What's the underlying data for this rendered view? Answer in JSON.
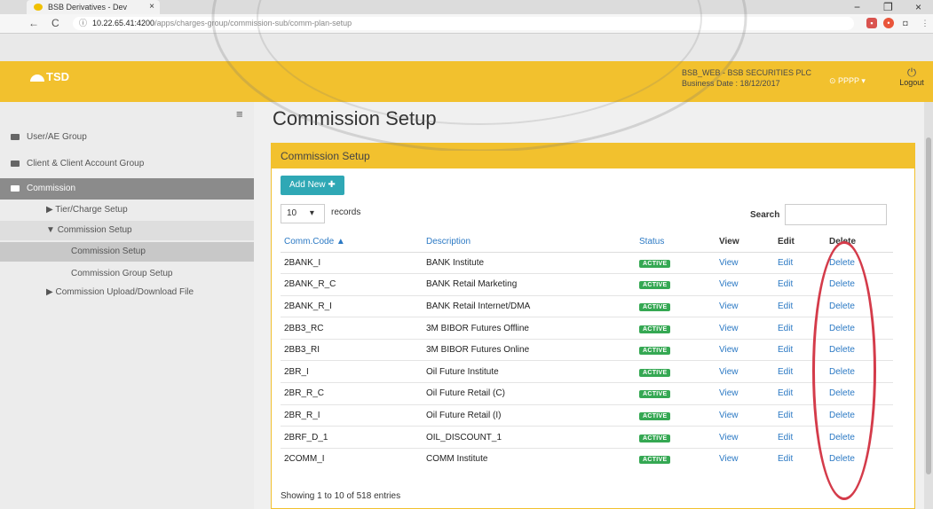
{
  "browser": {
    "tab_title": "BSB Derivatives - Dev",
    "tab_close": "×",
    "url_host": "10.22.65.41:4200",
    "url_path": "/apps/charges-group/commission-sub/comm-plan-setup",
    "back": "←",
    "reload": "C",
    "info": "ⓘ",
    "min": "−",
    "max": "❐",
    "close": "×"
  },
  "header": {
    "brand": "TSD",
    "company": "BSB_WEB - BSB SECURITIES PLC",
    "business_date": "Business Date : 18/12/2017",
    "user": "PPPP",
    "logout": "Logout"
  },
  "sidebar": {
    "items": [
      {
        "label": "User/AE Group"
      },
      {
        "label": "Client & Client Account Group"
      },
      {
        "label": "Commission"
      }
    ],
    "sub": [
      {
        "label": "Tier/Charge Setup"
      },
      {
        "label": "Commission Setup"
      },
      {
        "label": "Commission Setup"
      },
      {
        "label": "Commission Group Setup"
      },
      {
        "label": "Commission Upload/Download File"
      }
    ]
  },
  "main": {
    "title": "Commission Setup",
    "panel_title": "Commission Setup",
    "add_button": "Add New",
    "length_value": "10",
    "length_label": "records",
    "search_label": "Search",
    "columns": [
      "Comm.Code ▲",
      "Description",
      "Status",
      "View",
      "Edit",
      "Delete"
    ],
    "rows": [
      {
        "code": "2BANK_I",
        "desc": "BANK Institute",
        "status": "ACTIVE",
        "view": "View",
        "edit": "Edit",
        "delete": "Delete"
      },
      {
        "code": "2BANK_R_C",
        "desc": "BANK Retail Marketing",
        "status": "ACTIVE",
        "view": "View",
        "edit": "Edit",
        "delete": "Delete"
      },
      {
        "code": "2BANK_R_I",
        "desc": "BANK Retail Internet/DMA",
        "status": "ACTIVE",
        "view": "View",
        "edit": "Edit",
        "delete": "Delete"
      },
      {
        "code": "2BB3_RC",
        "desc": "3M BIBOR Futures Offline",
        "status": "ACTIVE",
        "view": "View",
        "edit": "Edit",
        "delete": "Delete"
      },
      {
        "code": "2BB3_RI",
        "desc": "3M BIBOR Futures Online",
        "status": "ACTIVE",
        "view": "View",
        "edit": "Edit",
        "delete": "Delete"
      },
      {
        "code": "2BR_I",
        "desc": "Oil Future Institute",
        "status": "ACTIVE",
        "view": "View",
        "edit": "Edit",
        "delete": "Delete"
      },
      {
        "code": "2BR_R_C",
        "desc": "Oil Future Retail (C)",
        "status": "ACTIVE",
        "view": "View",
        "edit": "Edit",
        "delete": "Delete"
      },
      {
        "code": "2BR_R_I",
        "desc": "Oil Future Retail (I)",
        "status": "ACTIVE",
        "view": "View",
        "edit": "Edit",
        "delete": "Delete"
      },
      {
        "code": "2BRF_D_1",
        "desc": "OIL_DISCOUNT_1",
        "status": "ACTIVE",
        "view": "View",
        "edit": "Edit",
        "delete": "Delete"
      },
      {
        "code": "2COMM_I",
        "desc": "COMM Institute",
        "status": "ACTIVE",
        "view": "View",
        "edit": "Edit",
        "delete": "Delete"
      }
    ],
    "info": "Showing 1 to 10 of 518 entries"
  },
  "colors": {
    "header": "#f2c12e",
    "accent": "#2fa8b5",
    "status": "#35a853",
    "link": "#2b79c4",
    "annotation": "#d43b4a"
  }
}
